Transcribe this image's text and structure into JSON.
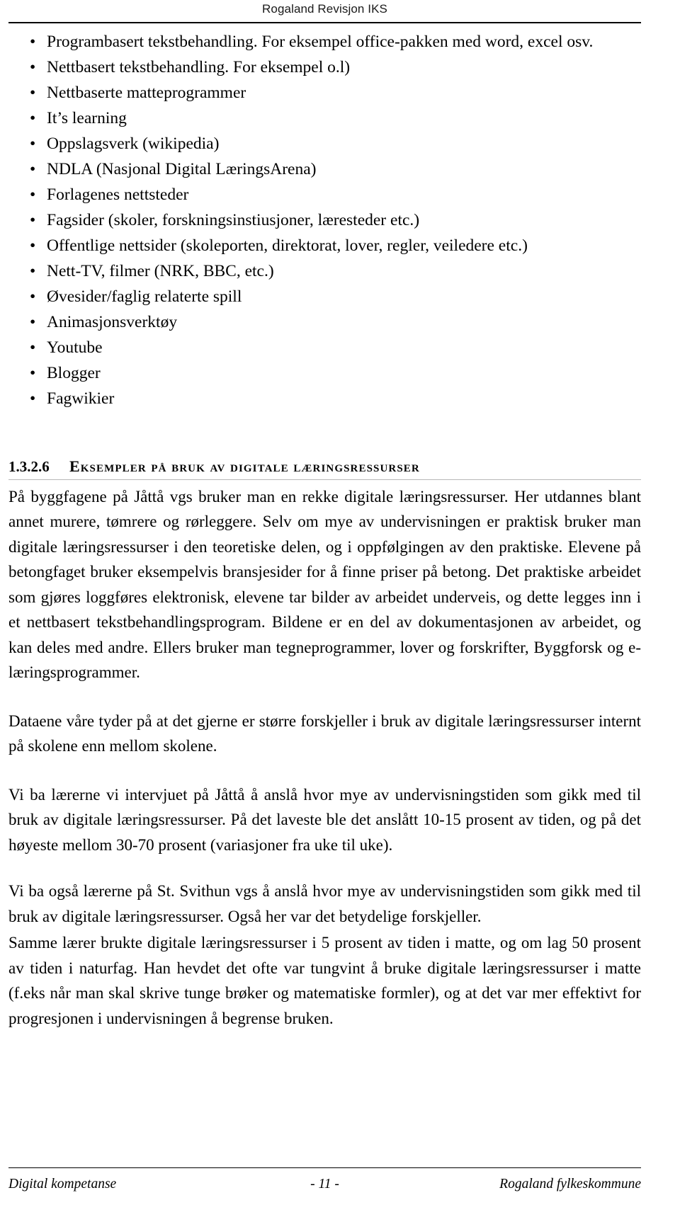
{
  "header": {
    "title": "Rogaland Revisjon IKS"
  },
  "bullets": {
    "marker": "•",
    "items": [
      "Programbasert tekstbehandling. For eksempel office-pakken med word, excel osv.",
      "Nettbasert tekstbehandling. For eksempel o.l)",
      "Nettbaserte matteprogrammer",
      "It’s learning",
      "Oppslagsverk (wikipedia)",
      "NDLA (Nasjonal Digital LæringsArena)",
      "Forlagenes nettsteder",
      "Fagsider (skoler, forskningsinstiusjoner, læresteder etc.)",
      "Offentlige nettsider (skoleporten, direktorat, lover, regler, veiledere etc.)",
      "Nett-TV, filmer (NRK, BBC, etc.)",
      "Øvesider/faglig relaterte spill",
      "Animasjonsverktøy",
      "Youtube",
      "Blogger",
      "Fagwikier"
    ]
  },
  "section": {
    "number": "1.3.2.6",
    "title": "Eksempler på bruk av digitale læringsressurser"
  },
  "paragraphs": [
    "På byggfagene på Jåttå vgs bruker man en rekke digitale læringsressurser. Her utdannes blant annet murere, tømrere og rørleggere. Selv om mye av undervisningen er praktisk bruker man digitale læringsressurser i den teoretiske delen, og i oppfølgingen av den praktiske. Elevene på betongfaget bruker eksempelvis bransjesider for å finne priser på betong. Det praktiske arbeidet som gjøres loggføres elektronisk, elevene tar bilder av arbeidet underveis, og dette legges inn i et nettbasert tekstbehandlingsprogram. Bildene er en del av dokumentasjonen av arbeidet, og kan deles med andre. Ellers bruker man tegneprogrammer, lover og forskrifter, Byggforsk og e-læringsprogrammer.",
    "Dataene våre tyder på at det gjerne er større forskjeller i bruk av digitale læringsressurser internt på skolene enn mellom skolene.",
    "Vi ba lærerne vi intervjuet på Jåttå å anslå hvor mye av undervisningstiden som gikk med til bruk av digitale læringsressurser. På det laveste ble det anslått 10-15 prosent av tiden, og på det høyeste mellom 30-70 prosent (variasjoner fra uke til uke).",
    "Vi ba også lærerne på St. Svithun vgs å anslå hvor mye av undervisningstiden som gikk med til bruk av digitale læringsressurser. Også her var det betydelige forskjeller.",
    "Samme lærer brukte digitale læringsressurser i 5 prosent av tiden i matte, og om lag 50 prosent av tiden i naturfag. Han hevdet det ofte var tungvint å bruke digitale læringsressurser i matte (f.eks når man skal skrive tunge brøker og matematiske formler), og at det var mer effektivt for progresjonen i undervisningen å begrense bruken."
  ],
  "footer": {
    "left": "Digital kompetanse",
    "center": "- 11 -",
    "right": "Rogaland fylkeskommune"
  }
}
